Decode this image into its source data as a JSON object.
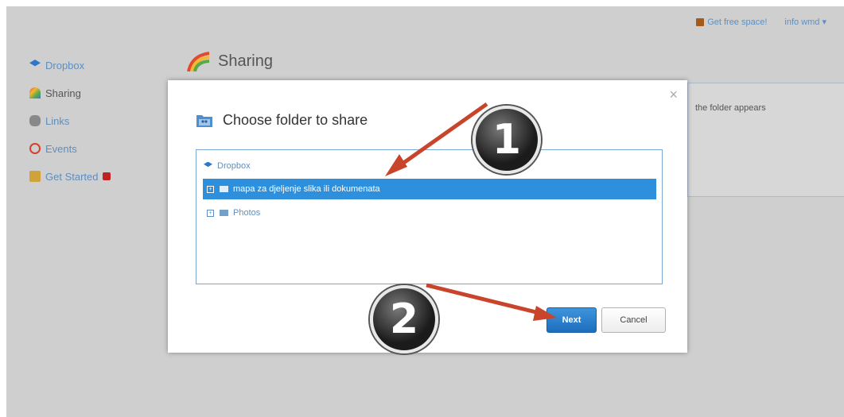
{
  "topbar": {
    "free_space": "Get free space!",
    "user": "info wmd ▾"
  },
  "sidebar": {
    "items": [
      {
        "label": "Dropbox",
        "icon": "dropbox-icon"
      },
      {
        "label": "Sharing",
        "icon": "sharing-icon"
      },
      {
        "label": "Links",
        "icon": "link-icon"
      },
      {
        "label": "Events",
        "icon": "events-icon"
      },
      {
        "label": "Get Started",
        "icon": "get-started-icon"
      }
    ]
  },
  "page": {
    "title": "Sharing",
    "panel_text": "the folder appears"
  },
  "modal": {
    "title": "Choose folder to share",
    "close": "×",
    "tree": {
      "root": "Dropbox",
      "items": [
        {
          "label": "mapa za djeljenje slika ili dokumenata",
          "selected": true
        },
        {
          "label": "Photos",
          "selected": false
        }
      ]
    },
    "next_label": "Next",
    "cancel_label": "Cancel"
  },
  "annotations": {
    "step1": "1",
    "step2": "2",
    "arrow_color": "#c8452b"
  }
}
